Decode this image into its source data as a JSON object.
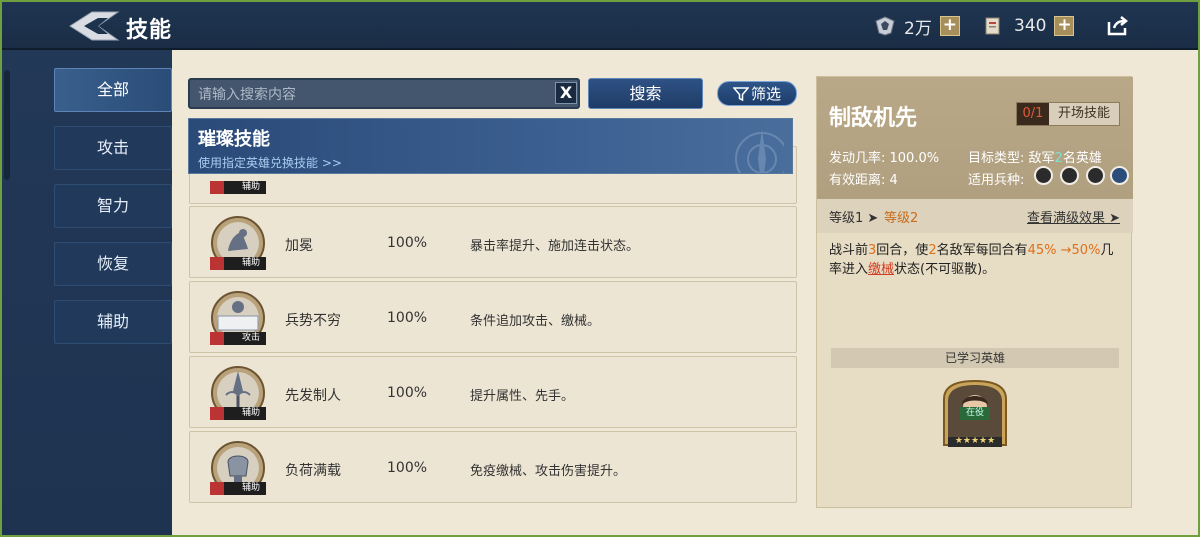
{
  "header": {
    "title": "技能",
    "resource1": "2万",
    "resource2": "340"
  },
  "nav": {
    "items": [
      "全部",
      "攻击",
      "智力",
      "恢复",
      "辅助"
    ]
  },
  "search": {
    "placeholder": "请输入搜索内容",
    "clear": "X",
    "button": "搜索",
    "filter": "筛选"
  },
  "banner": {
    "title": "璀璨技能",
    "subtitle": "使用指定英雄兑换技能 >>"
  },
  "partial_row": {
    "type": "辅助"
  },
  "skills": [
    {
      "name": "加冕",
      "rate": "100%",
      "desc": "暴击率提升、施加连击状态。",
      "type": "辅助"
    },
    {
      "name": "兵势不穷",
      "rate": "100%",
      "desc": "条件追加攻击、缴械。",
      "type": "攻击"
    },
    {
      "name": "先发制人",
      "rate": "100%",
      "desc": "提升属性、先手。",
      "type": "辅助"
    },
    {
      "name": "负荷满载",
      "rate": "100%",
      "desc": "免疫缴械、攻击伤害提升。",
      "type": "辅助"
    }
  ],
  "detail": {
    "name": "制敌机先",
    "count": "0/1",
    "kind": "开场技能",
    "trigger_label": "发动几率: ",
    "trigger_value": "100.0%",
    "range_label": "有效距离: ",
    "range_value": "4",
    "target_label": "目标类型: ",
    "target_a": "敌军",
    "target_num": "2",
    "target_b": "名英雄",
    "troops_label": "适用兵种:",
    "level1": "等级1 ➤",
    "level2": "等级2",
    "max_link": "查看满级效果 ➤",
    "effect": {
      "p1": "战斗前",
      "n1": "3",
      "p2": "回合，使",
      "n2": "2",
      "p3": "名敌军每回合有",
      "n3": "45% →50%",
      "p4": "几率进入",
      "status": "缴械",
      "p5": "状态(不可驱散)。"
    },
    "learned_title": "已学习英雄",
    "hero_status": "在役",
    "hero_stars": "★★★★★"
  },
  "colors": {
    "topbar": "#1f3551",
    "accent_orange": "#e0701c",
    "panel": "#e7dcc4"
  }
}
